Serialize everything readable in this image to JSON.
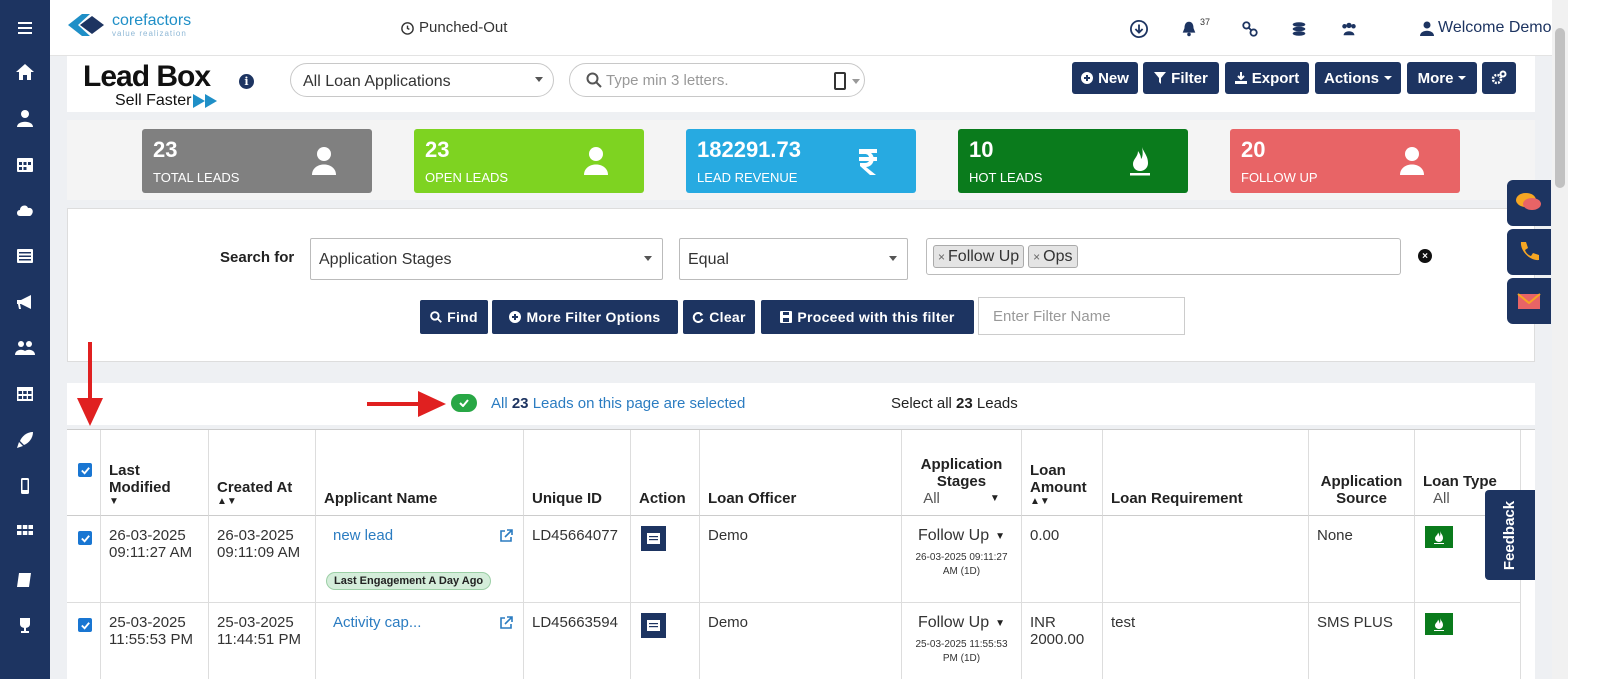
{
  "sidebar": {
    "icons": [
      "menu-icon",
      "home-icon",
      "user-icon",
      "calendar-icon",
      "cloud-icon",
      "list-icon",
      "megaphone-icon",
      "users-icon",
      "table-icon",
      "rocket-icon",
      "mobile-icon",
      "grid-icon",
      "book-icon",
      "trophy-icon"
    ]
  },
  "topbar": {
    "logo_name": "corefactors",
    "logo_tag": "value realization",
    "punch_status": "Punched-Out",
    "notif_count": "37",
    "welcome": "Welcome Demo"
  },
  "header": {
    "title": "Lead Box",
    "subtitle": "Sell Faster",
    "view_select": "All Loan Applications",
    "search_placeholder": "Type min 3 letters.",
    "buttons": {
      "new": "New",
      "filter": "Filter",
      "export": "Export",
      "actions": "Actions",
      "more": "More"
    }
  },
  "stats": [
    {
      "value": "23",
      "label": "TOTAL LEADS",
      "color": "#808080"
    },
    {
      "value": "23",
      "label": "OPEN LEADS",
      "color": "#7ed321"
    },
    {
      "value": "182291.73",
      "label": "LEAD REVENUE",
      "color": "#27aae1"
    },
    {
      "value": "10",
      "label": "HOT LEADS",
      "color": "#0a7b1c"
    },
    {
      "value": "20",
      "label": "FOLLOW UP",
      "color": "#e86466"
    }
  ],
  "filter": {
    "search_for_label": "Search for",
    "field": "Application Stages",
    "operator": "Equal",
    "tags": [
      "Follow Up",
      "Ops"
    ],
    "buttons": {
      "find": "Find",
      "more_options": "More Filter Options",
      "clear": "Clear",
      "proceed": "Proceed with this filter"
    },
    "filter_name_placeholder": "Enter Filter Name"
  },
  "selection": {
    "prefix": "All ",
    "count": "23",
    "suffix": " Leads on this page are selected",
    "select_all_prefix": "Select all ",
    "select_all_count": "23",
    "select_all_suffix": " Leads"
  },
  "table": {
    "headers": {
      "last_modified": "Last Modified",
      "created_at": "Created At",
      "applicant_name": "Applicant Name",
      "unique_id": "Unique ID",
      "action": "Action",
      "loan_officer": "Loan Officer",
      "application_stages": "Application Stages",
      "stages_filter": "All",
      "loan_amount": "Loan Amount",
      "loan_requirement": "Loan Requirement",
      "application_source": "Application Source",
      "loan_type": "Loan Type",
      "loan_type_filter": "All"
    },
    "rows": [
      {
        "last_modified_date": "26-03-2025",
        "last_modified_time": "09:11:27 AM",
        "created_date": "26-03-2025",
        "created_time": "09:11:09 AM",
        "applicant": "new lead",
        "engagement": "Last Engagement A Day Ago",
        "unique_id": "LD45664077",
        "officer": "Demo",
        "stage": "Follow Up",
        "stage_time1": "26-03-2025 09:11:27",
        "stage_time2": "AM (1D)",
        "amount1": "0.00",
        "amount2": "",
        "requirement": "",
        "source": "None"
      },
      {
        "last_modified_date": "25-03-2025",
        "last_modified_time": "11:55:53 PM",
        "created_date": "25-03-2025",
        "created_time": "11:44:51 PM",
        "applicant": "Activity cap...",
        "engagement": "",
        "unique_id": "LD45663594",
        "officer": "Demo",
        "stage": "Follow Up",
        "stage_time1": "25-03-2025 11:55:53",
        "stage_time2": "PM (1D)",
        "amount1": "INR",
        "amount2": "2000.00",
        "requirement": "test",
        "source": "SMS PLUS"
      }
    ]
  },
  "feedback_label": "Feedback",
  "colors": {
    "navy": "#1d3461",
    "link": "#2b7cc1",
    "annotation_red": "#e02020"
  }
}
